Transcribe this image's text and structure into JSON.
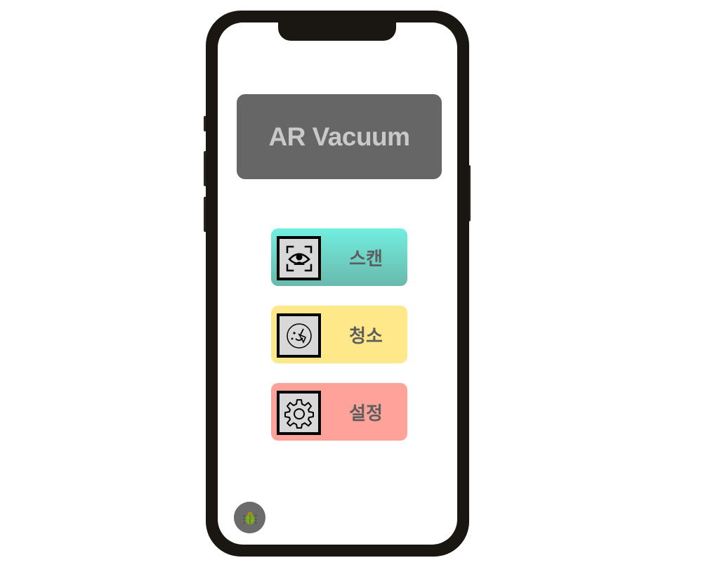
{
  "app": {
    "title": "AR Vacuum"
  },
  "menu": {
    "items": [
      {
        "label": "스캔",
        "icon": "scan-icon",
        "color": "#72efe0"
      },
      {
        "label": "청소",
        "icon": "cleaning-icon",
        "color": "#ffe88a"
      },
      {
        "label": "설정",
        "icon": "gear-icon",
        "color": "#ffa39a"
      }
    ]
  },
  "debug": {
    "icon": "bug-icon",
    "color": "#6b6b6b"
  }
}
